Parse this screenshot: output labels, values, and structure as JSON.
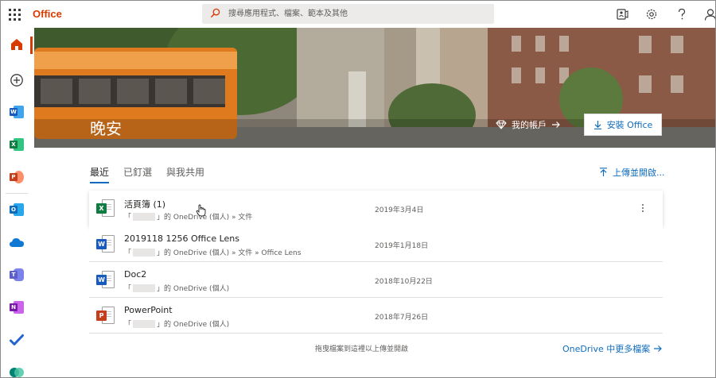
{
  "brand": {
    "name": "Office",
    "color": "#d83b01"
  },
  "search": {
    "placeholder": "搜尋應用程式、檔案、範本及其他"
  },
  "topbar_icons": [
    "meet-now-icon",
    "gear-icon",
    "help-icon",
    "account-icon"
  ],
  "rail": {
    "items": [
      {
        "name": "home",
        "icon": "home-icon"
      },
      {
        "name": "create",
        "icon": "plus-circle-icon"
      },
      {
        "name": "word",
        "letter": "W",
        "color": "#185abd"
      },
      {
        "name": "excel",
        "letter": "X",
        "color": "#107c41"
      },
      {
        "name": "powerpoint",
        "letter": "P",
        "color": "#c43e1c"
      },
      {
        "name": "outlook",
        "letter": "O",
        "color": "#0f6cbd"
      },
      {
        "name": "onedrive",
        "icon": "cloud-icon",
        "color": "#0f78d4"
      },
      {
        "name": "teams",
        "letter": "T",
        "color": "#5b5fc7"
      },
      {
        "name": "onenote",
        "letter": "N",
        "color": "#7719aa"
      },
      {
        "name": "todo",
        "icon": "check-icon",
        "color": "#2564cf"
      },
      {
        "name": "sway",
        "icon": "sway-icon",
        "color": "#008272"
      }
    ]
  },
  "hero": {
    "greeting": "晚安",
    "account_label": "我的帳戶",
    "install_label": "安裝 Office"
  },
  "tabs": [
    {
      "label": "最近",
      "active": true
    },
    {
      "label": "已釘選",
      "active": false
    },
    {
      "label": "與我共用",
      "active": false
    }
  ],
  "upload_label": "上傳並開啟...",
  "files": [
    {
      "name": "活頁簿 (1)",
      "type": "excel",
      "letter": "X",
      "color": "#107c41",
      "path_prefix": "「",
      "path_suffix": "」的 OneDrive (個人) » 文件",
      "date": "2019年3月4日"
    },
    {
      "name": "2019118 1256 Office Lens",
      "type": "word",
      "letter": "W",
      "color": "#185abd",
      "path_prefix": "「",
      "path_suffix": "」的 OneDrive (個人) » 文件 » Office Lens",
      "date": "2019年1月18日"
    },
    {
      "name": "Doc2",
      "type": "word",
      "letter": "W",
      "color": "#185abd",
      "path_prefix": "「",
      "path_suffix": "」的 OneDrive (個人)",
      "date": "2018年10月22日"
    },
    {
      "name": "PowerPoint",
      "type": "powerpoint",
      "letter": "P",
      "color": "#c43e1c",
      "path_prefix": "「",
      "path_suffix": "」的 OneDrive (個人)",
      "date": "2018年7月26日"
    }
  ],
  "footer": {
    "drop_hint": "拖曳檔案到這裡以上傳並開啟",
    "more_files": "OneDrive 中更多檔案"
  },
  "colors": {
    "accent": "#0f6cbd",
    "brand": "#d83b01"
  }
}
